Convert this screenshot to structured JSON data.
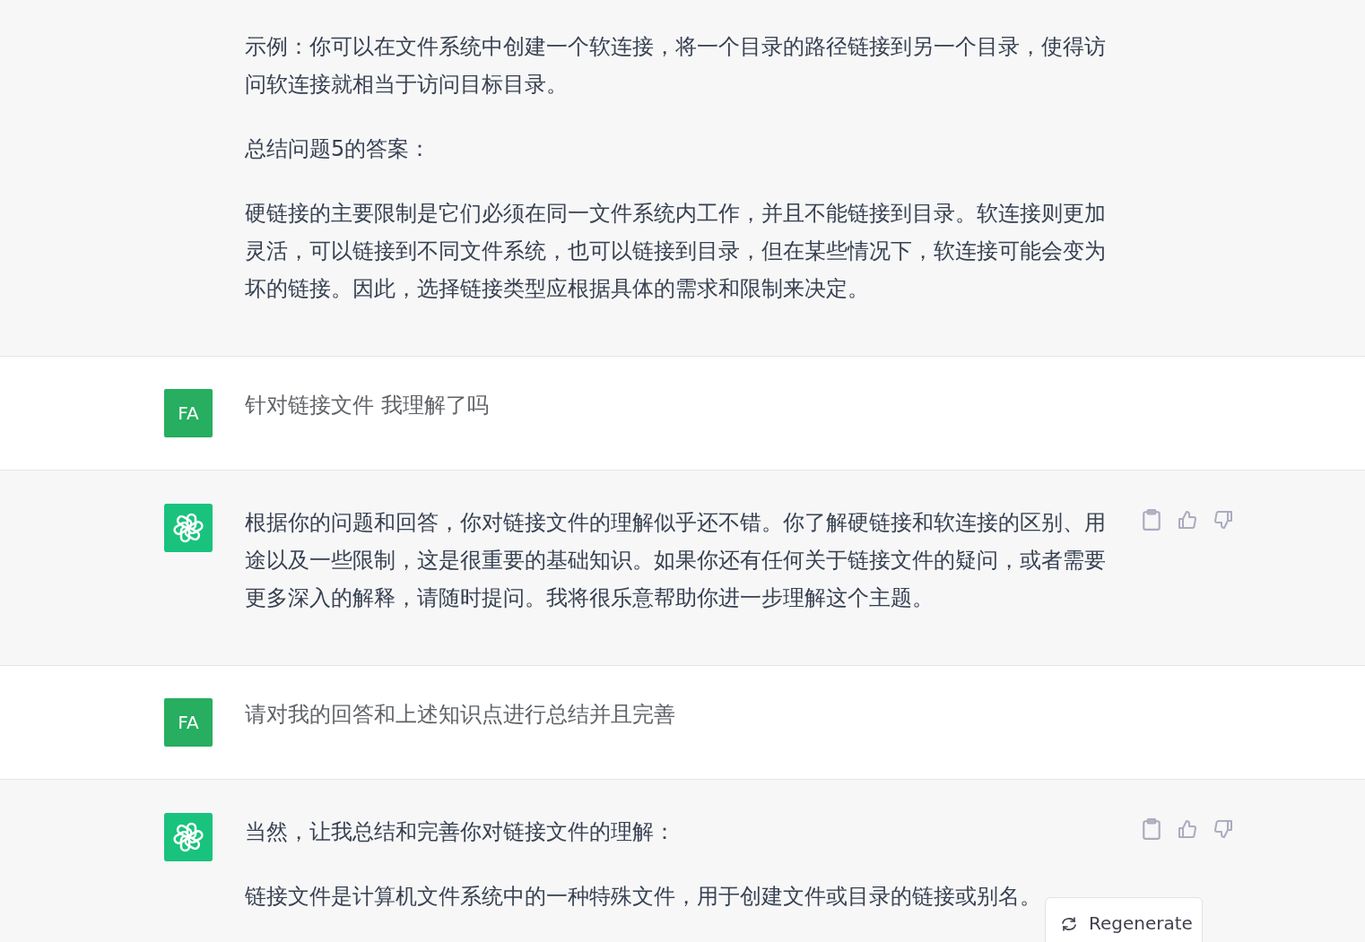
{
  "messages": [
    {
      "kind": "assistant",
      "continued": true,
      "actions": false,
      "paragraphs": [
        "示例：你可以在文件系统中创建一个软连接，将一个目录的路径链接到另一个目录，使得访问软连接就相当于访问目标目录。",
        "总结问题5的答案：",
        "硬链接的主要限制是它们必须在同一文件系统内工作，并且不能链接到目录。软连接则更加灵活，可以链接到不同文件系统，也可以链接到目录，但在某些情况下，软连接可能会变为坏的链接。因此，选择链接类型应根据具体的需求和限制来决定。"
      ]
    },
    {
      "kind": "user",
      "avatar": "FA",
      "paragraphs": [
        "针对链接文件 我理解了吗"
      ]
    },
    {
      "kind": "assistant",
      "continued": false,
      "actions": true,
      "paragraphs": [
        "根据你的问题和回答，你对链接文件的理解似乎还不错。你了解硬链接和软连接的区别、用途以及一些限制，这是很重要的基础知识。如果你还有任何关于链接文件的疑问，或者需要更多深入的解释，请随时提问。我将很乐意帮助你进一步理解这个主题。"
      ]
    },
    {
      "kind": "user",
      "avatar": "FA",
      "paragraphs": [
        "请对我的回答和上述知识点进行总结并且完善"
      ]
    },
    {
      "kind": "assistant",
      "continued": false,
      "actions": true,
      "paragraphs": [
        "当然，让我总结和完善你对链接文件的理解：",
        "链接文件是计算机文件系统中的一种特殊文件，用于创建文件或目录的链接或别名。"
      ]
    }
  ],
  "regenerate": {
    "label": "Regenerate"
  }
}
